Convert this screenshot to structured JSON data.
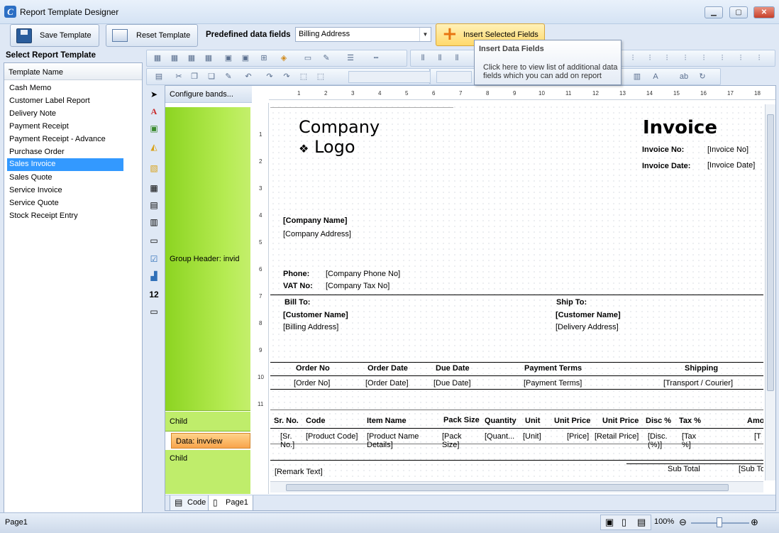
{
  "window": {
    "title": "Report Template Designer",
    "icon_letter": "C"
  },
  "toolbar": {
    "save_label": "Save Template",
    "reset_label": "Reset Template",
    "predefined_label": "Predefined data fields",
    "predefined_value": "Billing Address",
    "insert_label": "Insert Selected Fields"
  },
  "tooltip": {
    "title": "Insert Data Fields",
    "body": "Click here to view list of additional data fields which you can add on report"
  },
  "left_panel": {
    "heading": "Select Report Template",
    "column": "Template Name",
    "items": [
      "Cash Memo",
      "Customer Label Report",
      "Delivery Note",
      "Payment Receipt",
      "Payment Receipt - Advance",
      "Purchase Order",
      "Sales Invoice",
      "Sales Quote",
      "Service Invoice",
      "Service Quote",
      "Stock Receipt Entry"
    ],
    "selected": "Sales Invoice"
  },
  "bands": {
    "configure": "Configure bands...",
    "group_header": "Group Header: invid",
    "child1": "Child",
    "data": "Data: invview",
    "child2": "Child"
  },
  "ruler": {
    "h": [
      "1",
      "2",
      "3",
      "4",
      "5",
      "6",
      "7",
      "8",
      "9",
      "10",
      "11",
      "12",
      "13",
      "14",
      "15",
      "16",
      "17",
      "18"
    ],
    "v": [
      "1",
      "2",
      "3",
      "4",
      "5",
      "6",
      "7",
      "8",
      "9",
      "10",
      "11"
    ]
  },
  "report": {
    "logo_line1": "Company",
    "logo_line2": "Logo",
    "logo_symbol": "❖",
    "invoice_title": "Invoice",
    "invoice_no_label": "Invoice No:",
    "invoice_no_value": "[Invoice No]",
    "invoice_date_label": "Invoice Date:",
    "invoice_date_value": "[Invoice Date]",
    "company_name": "[Company Name]",
    "company_address": "[Company Address]",
    "phone_label": "Phone:",
    "phone_value": "[Company Phone No]",
    "vat_label": "VAT No:",
    "vat_value": "[Company Tax No]",
    "bill_to": "Bill To:",
    "bill_customer": "[Customer Name]",
    "billing_address": "[Billing Address]",
    "ship_to": "Ship To:",
    "ship_customer": "[Customer Name]",
    "delivery_address": "[Delivery Address]",
    "order_headers": [
      "Order No",
      "Order Date",
      "Due Date",
      "Payment Terms",
      "Shipping"
    ],
    "order_values": [
      "[Order No]",
      "[Order Date]",
      "[Due Date]",
      "[Payment Terms]",
      "[Transport / Courier]"
    ],
    "item_headers": [
      "Sr. No.",
      "Code",
      "Item Name",
      "Pack Size",
      "Quantity",
      "Unit",
      "Unit Price",
      "Unit Price",
      "Disc %",
      "Tax %",
      "Amo"
    ],
    "item_values": [
      "[Sr. No.]",
      "[Product Code]",
      "[Product Name Details]",
      "[Pack Size]",
      "[Quant...",
      "[Unit]",
      "[Price]",
      "[Retail Price]",
      "[Disc. (%)]",
      "[Tax %]",
      "[T"
    ],
    "remark": "[Remark Text]",
    "sub_total_label": "Sub Total",
    "sub_total_value": "[Sub To"
  },
  "tabs": {
    "code": "Code",
    "page": "Page1"
  },
  "status": {
    "page": "Page1",
    "zoom": "100%"
  }
}
